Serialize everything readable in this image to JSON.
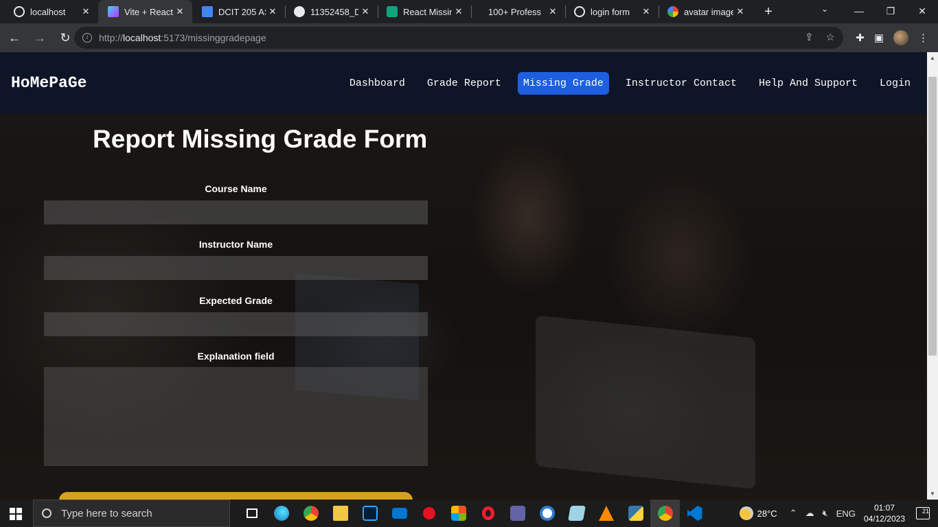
{
  "browser": {
    "tabs": [
      {
        "title": "localhost",
        "favicon_color": "#e8eaed",
        "active": false
      },
      {
        "title": "Vite + React",
        "favicon_color": "#a259ff",
        "active": true
      },
      {
        "title": "DCIT 205 AS",
        "favicon_color": "#4285f4",
        "active": false
      },
      {
        "title": "11352458_D",
        "favicon_color": "#e8eaed",
        "active": false
      },
      {
        "title": "React Missin",
        "favicon_color": "#10a37f",
        "active": false
      },
      {
        "title": "100+ Profess",
        "favicon_color": "#1f2023",
        "active": false
      },
      {
        "title": "login form",
        "favicon_color": "#e8eaed",
        "active": false
      },
      {
        "title": "avatar image",
        "favicon_color": "#ea4335",
        "active": false
      }
    ],
    "new_tab": "+",
    "url_prefix": "http://",
    "url_host": "localhost",
    "url_rest": ":5173/missinggradepage"
  },
  "site": {
    "brand": "HoMePaGe",
    "nav": [
      {
        "label": "Dashboard",
        "active": false
      },
      {
        "label": "Grade Report",
        "active": false
      },
      {
        "label": "Missing Grade",
        "active": true
      },
      {
        "label": "Instructor Contact",
        "active": false
      },
      {
        "label": "Help And Support",
        "active": false
      },
      {
        "label": "Login",
        "active": false
      }
    ],
    "active_color": "#1d5fe0",
    "navbar_color": "#0e1527"
  },
  "form": {
    "title": "Report Missing Grade Form",
    "fields": [
      {
        "label": "Course Name",
        "value": ""
      },
      {
        "label": "Instructor Name",
        "value": ""
      },
      {
        "label": "Expected Grade",
        "value": ""
      }
    ],
    "explanation_label": "Explanation field",
    "explanation_value": "",
    "submit_color": "#d6a21e"
  },
  "taskbar": {
    "search_placeholder": "Type here to search",
    "apps": [
      {
        "name": "task-view",
        "color": "#ffffff"
      },
      {
        "name": "edge",
        "color": "#1fa0e0"
      },
      {
        "name": "chrome",
        "color": "#34a853"
      },
      {
        "name": "file-explorer",
        "color": "#f2c744"
      },
      {
        "name": "photoshop",
        "color": "#31a8ff"
      },
      {
        "name": "mail",
        "color": "#0078d4"
      },
      {
        "name": "screen-recorder",
        "color": "#e81123"
      },
      {
        "name": "microsoft-store",
        "color": "#f25022"
      },
      {
        "name": "opera",
        "color": "#ff1b2d"
      },
      {
        "name": "teams",
        "color": "#6264a7"
      },
      {
        "name": "word-app",
        "color": "#2b7cd3"
      },
      {
        "name": "notes-app",
        "color": "#9fd3e8"
      },
      {
        "name": "vlc",
        "color": "#ff8800"
      },
      {
        "name": "python",
        "color": "#3776ab"
      },
      {
        "name": "chrome-active",
        "color": "#34a853"
      },
      {
        "name": "vscode",
        "color": "#0078d4"
      }
    ],
    "temperature": "28°C",
    "language": "ENG",
    "time": "01:07",
    "date": "04/12/2023",
    "notifications": "21"
  }
}
